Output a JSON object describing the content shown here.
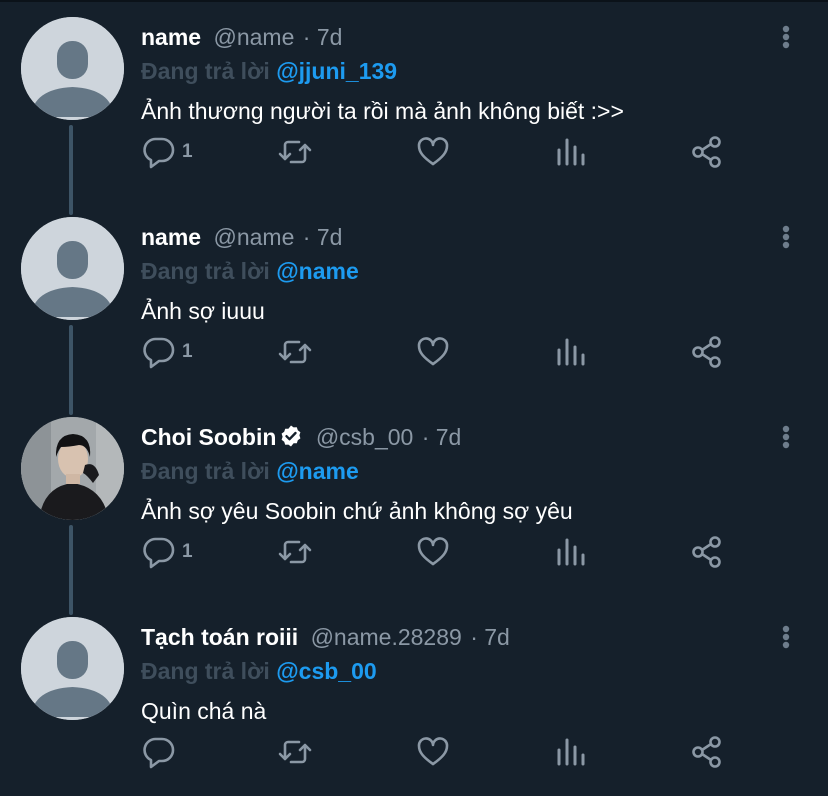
{
  "replying_prefix": "Đang trả lời",
  "tweets": [
    {
      "name": "name",
      "handle": "@name",
      "time": "· 7d",
      "reply_to": "@jjuni_139",
      "text": "Ảnh thương người ta rồi mà ảnh không biết :>>",
      "reply_count": "1",
      "avatar": "default-avatar"
    },
    {
      "name": "name",
      "handle": "@name",
      "time": "· 7d",
      "reply_to": "@name",
      "text": "Ảnh sợ iuuu",
      "reply_count": "1",
      "avatar": "default-avatar"
    },
    {
      "name": "Choi Soobin",
      "handle": "@csb_00",
      "time": "· 7d",
      "reply_to": "@name",
      "text": "Ảnh sợ yêu Soobin chứ ảnh không sợ yêu",
      "reply_count": "1",
      "avatar": "photo-avatar",
      "verified": true
    },
    {
      "name": "Tạch toán roiii",
      "handle": "@name.28289",
      "time": "· 7d",
      "reply_to": "@csb_00",
      "text": "Quìn chá nà",
      "reply_count": "",
      "avatar": "default-avatar"
    }
  ],
  "colors": {
    "background": "#15202b",
    "accent": "#1d9bf0",
    "muted": "#8b98a5",
    "thread_line": "#3d5466"
  }
}
